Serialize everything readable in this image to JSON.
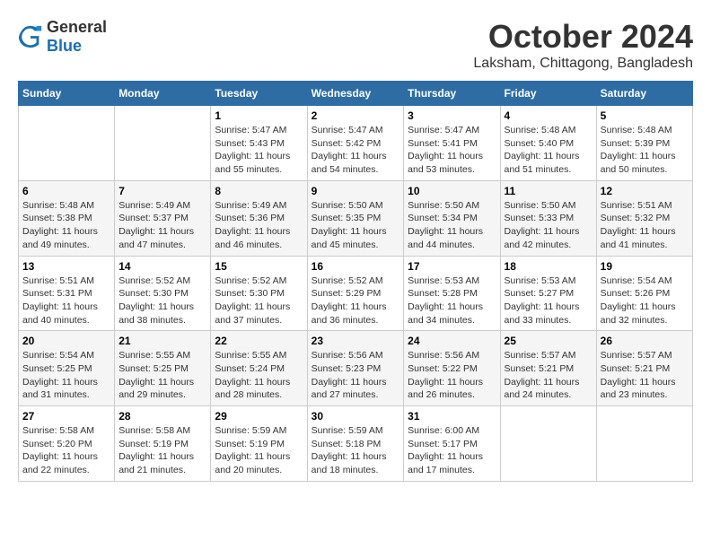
{
  "logo": {
    "general": "General",
    "blue": "Blue"
  },
  "title": "October 2024",
  "location": "Laksham, Chittagong, Bangladesh",
  "headers": [
    "Sunday",
    "Monday",
    "Tuesday",
    "Wednesday",
    "Thursday",
    "Friday",
    "Saturday"
  ],
  "weeks": [
    [
      {
        "day": "",
        "sunrise": "",
        "sunset": "",
        "daylight": ""
      },
      {
        "day": "",
        "sunrise": "",
        "sunset": "",
        "daylight": ""
      },
      {
        "day": "1",
        "sunrise": "Sunrise: 5:47 AM",
        "sunset": "Sunset: 5:43 PM",
        "daylight": "Daylight: 11 hours and 55 minutes."
      },
      {
        "day": "2",
        "sunrise": "Sunrise: 5:47 AM",
        "sunset": "Sunset: 5:42 PM",
        "daylight": "Daylight: 11 hours and 54 minutes."
      },
      {
        "day": "3",
        "sunrise": "Sunrise: 5:47 AM",
        "sunset": "Sunset: 5:41 PM",
        "daylight": "Daylight: 11 hours and 53 minutes."
      },
      {
        "day": "4",
        "sunrise": "Sunrise: 5:48 AM",
        "sunset": "Sunset: 5:40 PM",
        "daylight": "Daylight: 11 hours and 51 minutes."
      },
      {
        "day": "5",
        "sunrise": "Sunrise: 5:48 AM",
        "sunset": "Sunset: 5:39 PM",
        "daylight": "Daylight: 11 hours and 50 minutes."
      }
    ],
    [
      {
        "day": "6",
        "sunrise": "Sunrise: 5:48 AM",
        "sunset": "Sunset: 5:38 PM",
        "daylight": "Daylight: 11 hours and 49 minutes."
      },
      {
        "day": "7",
        "sunrise": "Sunrise: 5:49 AM",
        "sunset": "Sunset: 5:37 PM",
        "daylight": "Daylight: 11 hours and 47 minutes."
      },
      {
        "day": "8",
        "sunrise": "Sunrise: 5:49 AM",
        "sunset": "Sunset: 5:36 PM",
        "daylight": "Daylight: 11 hours and 46 minutes."
      },
      {
        "day": "9",
        "sunrise": "Sunrise: 5:50 AM",
        "sunset": "Sunset: 5:35 PM",
        "daylight": "Daylight: 11 hours and 45 minutes."
      },
      {
        "day": "10",
        "sunrise": "Sunrise: 5:50 AM",
        "sunset": "Sunset: 5:34 PM",
        "daylight": "Daylight: 11 hours and 44 minutes."
      },
      {
        "day": "11",
        "sunrise": "Sunrise: 5:50 AM",
        "sunset": "Sunset: 5:33 PM",
        "daylight": "Daylight: 11 hours and 42 minutes."
      },
      {
        "day": "12",
        "sunrise": "Sunrise: 5:51 AM",
        "sunset": "Sunset: 5:32 PM",
        "daylight": "Daylight: 11 hours and 41 minutes."
      }
    ],
    [
      {
        "day": "13",
        "sunrise": "Sunrise: 5:51 AM",
        "sunset": "Sunset: 5:31 PM",
        "daylight": "Daylight: 11 hours and 40 minutes."
      },
      {
        "day": "14",
        "sunrise": "Sunrise: 5:52 AM",
        "sunset": "Sunset: 5:30 PM",
        "daylight": "Daylight: 11 hours and 38 minutes."
      },
      {
        "day": "15",
        "sunrise": "Sunrise: 5:52 AM",
        "sunset": "Sunset: 5:30 PM",
        "daylight": "Daylight: 11 hours and 37 minutes."
      },
      {
        "day": "16",
        "sunrise": "Sunrise: 5:52 AM",
        "sunset": "Sunset: 5:29 PM",
        "daylight": "Daylight: 11 hours and 36 minutes."
      },
      {
        "day": "17",
        "sunrise": "Sunrise: 5:53 AM",
        "sunset": "Sunset: 5:28 PM",
        "daylight": "Daylight: 11 hours and 34 minutes."
      },
      {
        "day": "18",
        "sunrise": "Sunrise: 5:53 AM",
        "sunset": "Sunset: 5:27 PM",
        "daylight": "Daylight: 11 hours and 33 minutes."
      },
      {
        "day": "19",
        "sunrise": "Sunrise: 5:54 AM",
        "sunset": "Sunset: 5:26 PM",
        "daylight": "Daylight: 11 hours and 32 minutes."
      }
    ],
    [
      {
        "day": "20",
        "sunrise": "Sunrise: 5:54 AM",
        "sunset": "Sunset: 5:25 PM",
        "daylight": "Daylight: 11 hours and 31 minutes."
      },
      {
        "day": "21",
        "sunrise": "Sunrise: 5:55 AM",
        "sunset": "Sunset: 5:25 PM",
        "daylight": "Daylight: 11 hours and 29 minutes."
      },
      {
        "day": "22",
        "sunrise": "Sunrise: 5:55 AM",
        "sunset": "Sunset: 5:24 PM",
        "daylight": "Daylight: 11 hours and 28 minutes."
      },
      {
        "day": "23",
        "sunrise": "Sunrise: 5:56 AM",
        "sunset": "Sunset: 5:23 PM",
        "daylight": "Daylight: 11 hours and 27 minutes."
      },
      {
        "day": "24",
        "sunrise": "Sunrise: 5:56 AM",
        "sunset": "Sunset: 5:22 PM",
        "daylight": "Daylight: 11 hours and 26 minutes."
      },
      {
        "day": "25",
        "sunrise": "Sunrise: 5:57 AM",
        "sunset": "Sunset: 5:21 PM",
        "daylight": "Daylight: 11 hours and 24 minutes."
      },
      {
        "day": "26",
        "sunrise": "Sunrise: 5:57 AM",
        "sunset": "Sunset: 5:21 PM",
        "daylight": "Daylight: 11 hours and 23 minutes."
      }
    ],
    [
      {
        "day": "27",
        "sunrise": "Sunrise: 5:58 AM",
        "sunset": "Sunset: 5:20 PM",
        "daylight": "Daylight: 11 hours and 22 minutes."
      },
      {
        "day": "28",
        "sunrise": "Sunrise: 5:58 AM",
        "sunset": "Sunset: 5:19 PM",
        "daylight": "Daylight: 11 hours and 21 minutes."
      },
      {
        "day": "29",
        "sunrise": "Sunrise: 5:59 AM",
        "sunset": "Sunset: 5:19 PM",
        "daylight": "Daylight: 11 hours and 20 minutes."
      },
      {
        "day": "30",
        "sunrise": "Sunrise: 5:59 AM",
        "sunset": "Sunset: 5:18 PM",
        "daylight": "Daylight: 11 hours and 18 minutes."
      },
      {
        "day": "31",
        "sunrise": "Sunrise: 6:00 AM",
        "sunset": "Sunset: 5:17 PM",
        "daylight": "Daylight: 11 hours and 17 minutes."
      },
      {
        "day": "",
        "sunrise": "",
        "sunset": "",
        "daylight": ""
      },
      {
        "day": "",
        "sunrise": "",
        "sunset": "",
        "daylight": ""
      }
    ]
  ]
}
